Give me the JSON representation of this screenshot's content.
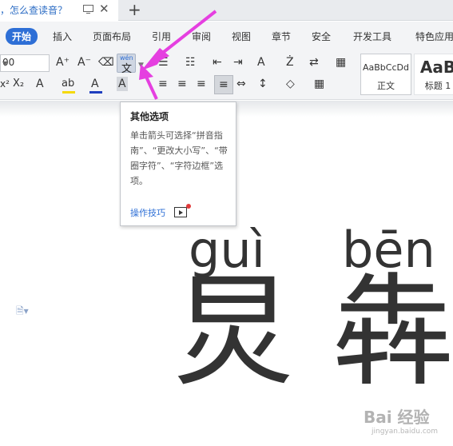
{
  "tab": {
    "title": "，怎么查读音？",
    "close_glyph": "✕",
    "new_glyph": "+"
  },
  "menu": {
    "items": [
      "开始",
      "插入",
      "页面布局",
      "引用",
      "审阅",
      "视图",
      "章节",
      "安全",
      "开发工具",
      "特色应用"
    ],
    "active_index": 0
  },
  "toolbar": {
    "font_size_value": "00",
    "pinyin_superscript": "wén",
    "pinyin_char": "文",
    "row1_glyphs": [
      "A⁺",
      "A⁻",
      "⌫",
      "☰",
      "☷",
      "⇤",
      "⇥",
      "A",
      "Ż",
      "⇄",
      "▦"
    ],
    "row2_glyphs": [
      "x²",
      "X₂",
      "A",
      "ab",
      "A",
      "A",
      "≡",
      "≡",
      "≡",
      "≡",
      "⇔",
      "↕",
      "◇",
      "▦"
    ],
    "styles": [
      {
        "sample": "AaBbCcDd",
        "name": "正文"
      },
      {
        "sample": "AaB",
        "name": "标题 1"
      }
    ]
  },
  "tooltip": {
    "title": "其他选项",
    "body": "单击箭头可选择“拼音指南”、“更改大小写”、“带圈字符”、“字符边框”选项。",
    "link": "操作技巧"
  },
  "document": {
    "pinyin": [
      "guì",
      "bēn"
    ],
    "hanzi": [
      "炅",
      "犇"
    ]
  },
  "watermark": {
    "logo": "Bai  经验",
    "url": "jingyan.baidu.com"
  },
  "colors": {
    "accent": "#2e6fd6",
    "arrow": "#e53fe0",
    "font_color_bar": "#1f3fbf",
    "highlight_bar": "#f5d90a"
  }
}
